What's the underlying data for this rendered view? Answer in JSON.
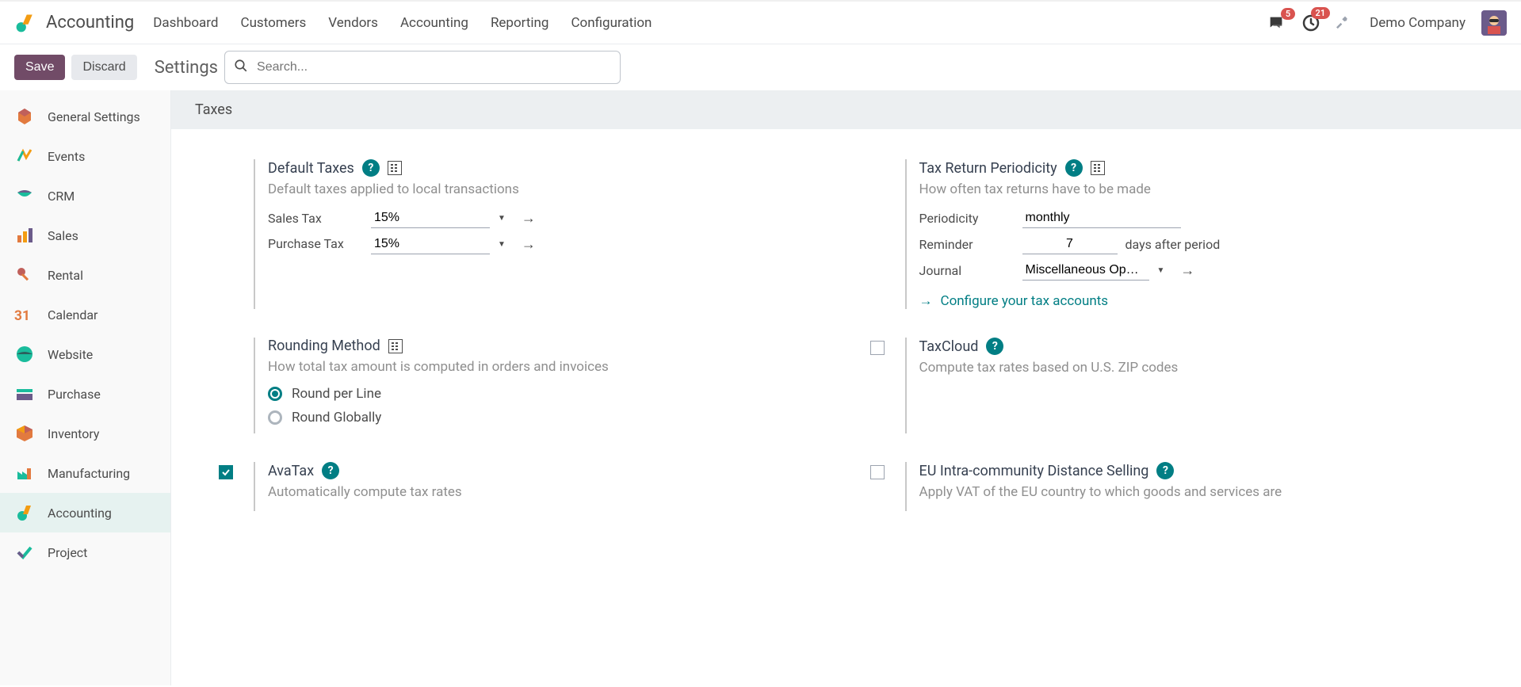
{
  "header": {
    "app_title": "Accounting",
    "nav": [
      "Dashboard",
      "Customers",
      "Vendors",
      "Accounting",
      "Reporting",
      "Configuration"
    ],
    "messages_badge": "5",
    "activities_badge": "21",
    "company": "Demo Company"
  },
  "toolbar": {
    "save_label": "Save",
    "discard_label": "Discard",
    "page_title": "Settings",
    "search_placeholder": "Search..."
  },
  "sidebar": {
    "items": [
      {
        "label": "General Settings"
      },
      {
        "label": "Events"
      },
      {
        "label": "CRM"
      },
      {
        "label": "Sales"
      },
      {
        "label": "Rental"
      },
      {
        "label": "Calendar"
      },
      {
        "label": "Website"
      },
      {
        "label": "Purchase"
      },
      {
        "label": "Inventory"
      },
      {
        "label": "Manufacturing"
      },
      {
        "label": "Accounting"
      },
      {
        "label": "Project"
      }
    ],
    "active": "Accounting"
  },
  "section": {
    "title": "Taxes"
  },
  "settings": {
    "default_taxes": {
      "title": "Default Taxes",
      "desc": "Default taxes applied to local transactions",
      "sales_tax_label": "Sales Tax",
      "sales_tax_value": "15%",
      "purchase_tax_label": "Purchase Tax",
      "purchase_tax_value": "15%"
    },
    "tax_return": {
      "title": "Tax Return Periodicity",
      "desc": "How often tax returns have to be made",
      "periodicity_label": "Periodicity",
      "periodicity_value": "monthly",
      "reminder_label": "Reminder",
      "reminder_value": "7",
      "reminder_suffix": "days after period",
      "journal_label": "Journal",
      "journal_value": "Miscellaneous Operations",
      "config_link": "Configure your tax accounts"
    },
    "rounding": {
      "title": "Rounding Method",
      "desc": "How total tax amount is computed in orders and invoices",
      "option1": "Round per Line",
      "option2": "Round Globally"
    },
    "taxcloud": {
      "title": "TaxCloud",
      "desc": "Compute tax rates based on U.S. ZIP codes"
    },
    "avatax": {
      "title": "AvaTax",
      "desc": "Automatically compute tax rates"
    },
    "eu_distance": {
      "title": "EU Intra-community Distance Selling",
      "desc": "Apply VAT of the EU country to which goods and services are"
    }
  }
}
